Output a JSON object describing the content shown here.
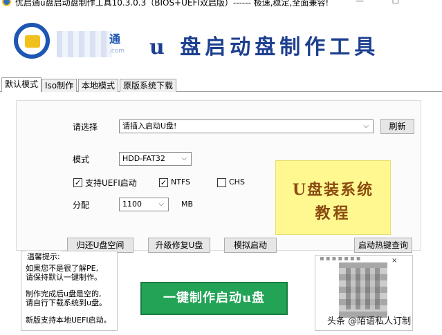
{
  "window": {
    "title": "优启通u盘启动盘制作工具10.3.0.3（BIOS+UEFI双启版）------ 极速,稳定,全面兼容!",
    "minimize_label": "—",
    "maximize_label": "☐"
  },
  "banner": {
    "logo_text": "通",
    "logo_sub": ".com",
    "title": "u 盘启动盘制作工具"
  },
  "tabs": [
    {
      "label": "默认模式",
      "active": true
    },
    {
      "label": "Iso制作",
      "active": false
    },
    {
      "label": "本地模式",
      "active": false
    },
    {
      "label": "原版系统下载",
      "active": false
    }
  ],
  "form": {
    "select_label": "请选择",
    "device_value": "请插入启动U盘!",
    "refresh_label": "刷新",
    "mode_label": "模式",
    "mode_value": "HDD-FAT32",
    "uefi_label": "支持UEFI启动",
    "uefi_checked": true,
    "ntfs_label": "NTFS",
    "ntfs_checked": true,
    "chs_label": "CHS",
    "chs_checked": false,
    "alloc_label": "分配",
    "alloc_value": "1100",
    "alloc_unit": "MB"
  },
  "actions": {
    "restore_label": "归还U盘空间",
    "upgrade_label": "升级修复U盘",
    "simulate_label": "模拟启动",
    "hotkey_label": "启动热键查询",
    "one_click_label": "一键制作启动u盘"
  },
  "promo": {
    "line1": "U盘装系统",
    "line2": "教程"
  },
  "tips": {
    "title": "温馨提示:",
    "lines": [
      "如果您不是很了解PE,",
      "请保持默认一键制作。",
      "制作完成后u盘是空的,",
      "请自行下载系统到u盘。",
      "新版支持本地UEFI启动。"
    ]
  },
  "qr_panel": {
    "close_glyph": "×",
    "watermark": "头条 @陌语私人订制"
  }
}
